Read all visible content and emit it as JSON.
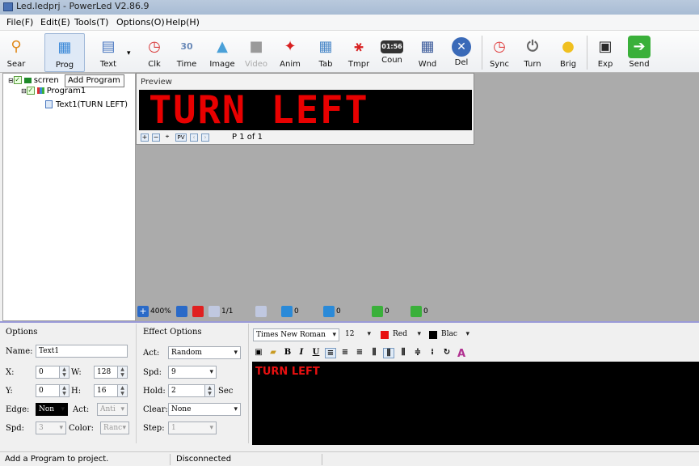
{
  "window": {
    "title": "Led.ledprj - PowerLed V2.86.9"
  },
  "menu": [
    "File(F)",
    "Edit(E)",
    "Tools(T)",
    "Options(O)",
    "Help(H)"
  ],
  "toolbar": [
    {
      "label": "Sear",
      "icon": "search-icon",
      "color": "#e08a1a"
    },
    {
      "label": "Prog",
      "icon": "program-icon",
      "color": "#3a88d8"
    },
    {
      "label": "Text",
      "icon": "text-icon",
      "color": "#4a78c0"
    },
    {
      "label": "Clk",
      "icon": "clock-icon",
      "color": "#d83a3a"
    },
    {
      "label": "Time",
      "icon": "calendar-icon",
      "color": "#6a8ab8"
    },
    {
      "label": "Image",
      "icon": "image-icon",
      "color": "#4aa0d8"
    },
    {
      "label": "Video",
      "icon": "video-icon",
      "color": "#8a8a8a"
    },
    {
      "label": "Anim",
      "icon": "animation-icon",
      "color": "#d82020"
    },
    {
      "label": "Tab",
      "icon": "table-icon",
      "color": "#4a88c8"
    },
    {
      "label": "Tmpr",
      "icon": "thermometer-icon",
      "color": "#d82020"
    },
    {
      "label": "Coun",
      "icon": "counter-icon",
      "color": "#333333"
    },
    {
      "label": "Wnd",
      "icon": "window-icon",
      "color": "#3a5a9a"
    },
    {
      "label": "Del",
      "icon": "delete-icon",
      "color": "#3a6ab8"
    },
    {
      "label": "Sync",
      "icon": "alarm-clock-icon",
      "color": "#e04040"
    },
    {
      "label": "Turn",
      "icon": "power-icon",
      "color": "#666666"
    },
    {
      "label": "Brig",
      "icon": "bulb-icon",
      "color": "#f0c020"
    },
    {
      "label": "Exp",
      "icon": "export-icon",
      "color": "#2a2a2a"
    },
    {
      "label": "Send",
      "icon": "send-arrow-icon",
      "color": "#3ab03a"
    }
  ],
  "tree": {
    "screen": "scrren",
    "program": "Program1",
    "text": "Text1(TURN LEFT)"
  },
  "tooltip": "Add Program",
  "preview": {
    "title": "Preview",
    "led_text": "TURN LEFT",
    "page": "P 1 of 1",
    "pv": "PV"
  },
  "canvas_bar": {
    "zoom": "400%",
    "page": "1/1",
    "v1": "0",
    "v2": "0",
    "v3": "0",
    "v4": "0"
  },
  "options": {
    "title": "Options",
    "name_label": "Name:",
    "name": "Text1",
    "x_label": "X:",
    "x": "0",
    "w_label": "W:",
    "w": "128",
    "y_label": "Y:",
    "y": "0",
    "h_label": "H:",
    "h": "16",
    "edge_label": "Edge:",
    "edge": "Non",
    "act_label": "Act:",
    "act": "Anti",
    "spd_label": "Spd:",
    "spd": "3",
    "color_label": "Color:",
    "color": "Ranc"
  },
  "effect": {
    "title": "Effect Options",
    "act_label": "Act:",
    "act": "Random",
    "spd_label": "Spd:",
    "spd": "9",
    "hold_label": "Hold:",
    "hold": "2",
    "hold_unit": "Sec",
    "clear_label": "Clear:",
    "clear": "None",
    "step_label": "Step:",
    "step": "1"
  },
  "editor": {
    "font": "Times New Roman",
    "size": "12",
    "fg_label": "Red",
    "fg_color": "#e81010",
    "bg_label": "Blac",
    "bg_color": "#000000",
    "content": "TURN LEFT"
  },
  "status": {
    "left": "Add a Program to project.",
    "right": "Disconnected"
  }
}
